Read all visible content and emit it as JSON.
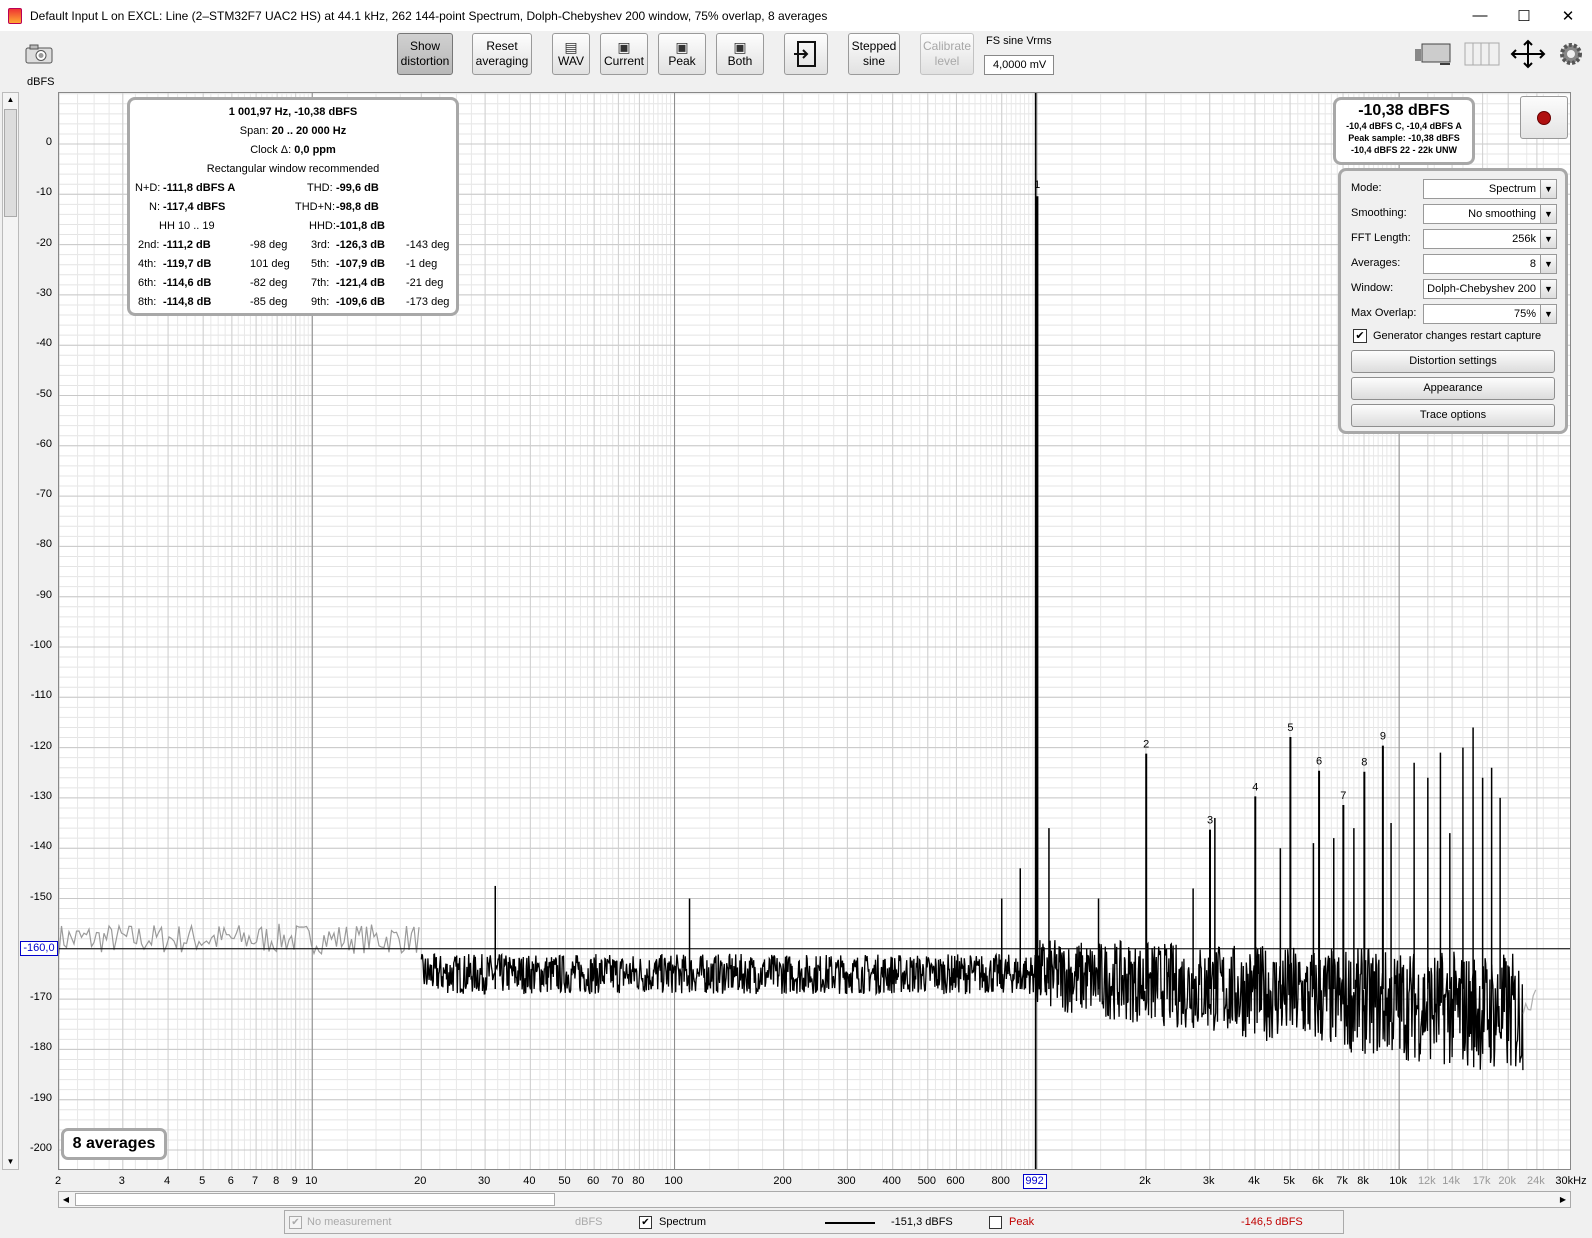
{
  "window": {
    "title": "Default Input L on EXCL: Line (2–STM32F7 UAC2 HS) at 44.1 kHz, 262 144-point Spectrum, Dolph-Chebyshev 200 window, 75% overlap, 8 averages",
    "minimize": "—",
    "maximize": "☐",
    "close": "✕"
  },
  "toolbar": {
    "show_distortion": [
      "Show",
      "distortion"
    ],
    "reset_averaging": [
      "Reset",
      "averaging"
    ],
    "wav": "WAV",
    "current": "Current",
    "peak": "Peak",
    "both": "Both",
    "stepped_sine": [
      "Stepped",
      "sine"
    ],
    "calibrate_level": [
      "Calibrate",
      "level"
    ],
    "fs_sine_label": "FS sine Vrms",
    "fs_sine_value": "4,0000 mV"
  },
  "icons": [
    "camera-icon",
    "save-icon",
    "folder-icon",
    "import-icon",
    "layout-icon",
    "columns-icon",
    "expand-icon",
    "gear-icon"
  ],
  "chart_data": {
    "type": "line",
    "ylabel": "dBFS",
    "ylim": [
      -200,
      10
    ],
    "xscale": "log",
    "xlim": [
      2,
      30000
    ],
    "y_ticks": [
      0,
      -10,
      -20,
      -30,
      -40,
      -50,
      -60,
      -70,
      -80,
      -90,
      -100,
      -110,
      -120,
      -130,
      -140,
      -150,
      -160,
      -170,
      -180,
      -190,
      -200
    ],
    "x_ticks": [
      {
        "v": 2,
        "l": "2"
      },
      {
        "v": 3,
        "l": "3"
      },
      {
        "v": 4,
        "l": "4"
      },
      {
        "v": 5,
        "l": "5"
      },
      {
        "v": 6,
        "l": "6"
      },
      {
        "v": 7,
        "l": "7"
      },
      {
        "v": 8,
        "l": "8"
      },
      {
        "v": 9,
        "l": "9"
      },
      {
        "v": 10,
        "l": "10"
      },
      {
        "v": 20,
        "l": "20"
      },
      {
        "v": 30,
        "l": "30"
      },
      {
        "v": 40,
        "l": "40"
      },
      {
        "v": 50,
        "l": "50"
      },
      {
        "v": 60,
        "l": "60"
      },
      {
        "v": 70,
        "l": "70"
      },
      {
        "v": 80,
        "l": "80"
      },
      {
        "v": 100,
        "l": "100"
      },
      {
        "v": 200,
        "l": "200"
      },
      {
        "v": 300,
        "l": "300"
      },
      {
        "v": 400,
        "l": "400"
      },
      {
        "v": 500,
        "l": "500"
      },
      {
        "v": 600,
        "l": "600"
      },
      {
        "v": 800,
        "l": "800"
      },
      {
        "v": 2000,
        "l": "2k"
      },
      {
        "v": 3000,
        "l": "3k"
      },
      {
        "v": 4000,
        "l": "4k"
      },
      {
        "v": 5000,
        "l": "5k"
      },
      {
        "v": 6000,
        "l": "6k"
      },
      {
        "v": 7000,
        "l": "7k"
      },
      {
        "v": 8000,
        "l": "8k"
      },
      {
        "v": 10000,
        "l": "10k"
      }
    ],
    "x_ticks_minor": [
      {
        "v": 12000,
        "l": "12k"
      },
      {
        "v": 14000,
        "l": "14k"
      },
      {
        "v": 17000,
        "l": "17k"
      },
      {
        "v": 20000,
        "l": "20k"
      },
      {
        "v": 24000,
        "l": "24k"
      },
      {
        "v": 30000,
        "l": "30kHz"
      }
    ],
    "cursor_x": {
      "value": 992,
      "label": "992"
    },
    "cursor_y": {
      "value": -160,
      "label": "-160,0"
    },
    "fundamental": {
      "freq": 1002,
      "level": -10.38,
      "label": "1"
    },
    "harmonics": [
      {
        "n": "2",
        "freq": 2004,
        "level": -121.2
      },
      {
        "n": "3",
        "freq": 3006,
        "level": -136.3
      },
      {
        "n": "4",
        "freq": 4008,
        "level": -129.7
      },
      {
        "n": "5",
        "freq": 5010,
        "level": -117.9
      },
      {
        "n": "6",
        "freq": 6012,
        "level": -124.6
      },
      {
        "n": "7",
        "freq": 7014,
        "level": -131.4
      },
      {
        "n": "8",
        "freq": 8016,
        "level": -124.8
      },
      {
        "n": "9",
        "freq": 9018,
        "level": -119.6
      }
    ],
    "spurs": [
      {
        "freq": 32,
        "level": -147.5
      },
      {
        "freq": 110,
        "level": -150
      },
      {
        "freq": 800,
        "level": -150
      },
      {
        "freq": 900,
        "level": -144
      },
      {
        "freq": 1080,
        "level": -136
      },
      {
        "freq": 1480,
        "level": -150
      },
      {
        "freq": 2700,
        "level": -148
      },
      {
        "freq": 3100,
        "level": -134
      },
      {
        "freq": 4700,
        "level": -140
      },
      {
        "freq": 5800,
        "level": -139
      },
      {
        "freq": 6600,
        "level": -138
      },
      {
        "freq": 7500,
        "level": -136
      },
      {
        "freq": 9500,
        "level": -135
      },
      {
        "freq": 11000,
        "level": -123
      },
      {
        "freq": 12000,
        "level": -126
      },
      {
        "freq": 13000,
        "level": -121
      },
      {
        "freq": 13800,
        "level": -137
      },
      {
        "freq": 15000,
        "level": -120
      },
      {
        "freq": 16000,
        "level": -116
      },
      {
        "freq": 17000,
        "level": -126
      },
      {
        "freq": 18000,
        "level": -124
      },
      {
        "freq": 19000,
        "level": -130
      }
    ],
    "noise_floor_segments": [
      {
        "from": 2,
        "to": 20,
        "level": -158,
        "color": "#9a9a9a"
      },
      {
        "from": 20,
        "to": 22000,
        "level": -165,
        "color": "#000000"
      },
      {
        "from": 22000,
        "to": 24000,
        "level": -170,
        "color": "#b0b0b0"
      }
    ]
  },
  "info_panel": {
    "headline": "1 001,97 Hz, -10,38 dBFS",
    "span_label": "Span:",
    "span_value": "20 .. 20 000 Hz",
    "clock_label": "Clock Δ:",
    "clock_value": "0,0 ppm",
    "recommend": "Rectangular window recommended",
    "nd_label": "N+D:",
    "nd_value": "-111,8 dBFS A",
    "thd_label": "THD:",
    "thd_value": "-99,6 dB",
    "n_label": "N:",
    "n_value": "-117,4 dBFS",
    "thdn_label": "THD+N:",
    "thdn_value": "-98,8 dB",
    "hh_label": "HH 10 .. 19",
    "hhd_label": "HHD:",
    "hhd_value": "-101,8 dB",
    "harmonics": [
      {
        "l1": "2nd:",
        "v1": "-111,2 dB",
        "p1": "-98 deg",
        "l2": "3rd:",
        "v2": "-126,3 dB",
        "p2": "-143 deg"
      },
      {
        "l1": "4th:",
        "v1": "-119,7 dB",
        "p1": "101 deg",
        "l2": "5th:",
        "v2": "-107,9 dB",
        "p2": "-1 deg"
      },
      {
        "l1": "6th:",
        "v1": "-114,6 dB",
        "p1": "-82 deg",
        "l2": "7th:",
        "v2": "-121,4 dB",
        "p2": "-21 deg"
      },
      {
        "l1": "8th:",
        "v1": "-114,8 dB",
        "p1": "-85 deg",
        "l2": "9th:",
        "v2": "-109,6 dB",
        "p2": "-173 deg"
      }
    ]
  },
  "level_box": {
    "big": "-10,38 dBFS",
    "line1": "-10,4 dBFS C, -10,4 dBFS A",
    "line2": "Peak sample: -10,38 dBFS",
    "line3": "-10,4 dBFS 22 - 22k UNW"
  },
  "settings": {
    "mode_label": "Mode:",
    "mode_value": "Spectrum",
    "smoothing_label": "Smoothing:",
    "smoothing_value": "No  smoothing",
    "fft_label": "FFT Length:",
    "fft_value": "256k",
    "averages_label": "Averages:",
    "averages_value": "8",
    "window_label": "Window:",
    "window_value": "Dolph-Chebyshev 200",
    "overlap_label": "Max Overlap:",
    "overlap_value": "75%",
    "restart_label": "Generator changes restart capture",
    "restart_checked": "✔",
    "distortion_btn": "Distortion settings",
    "appearance_btn": "Appearance",
    "trace_btn": "Trace options"
  },
  "averages_badge": "8 averages",
  "legend": {
    "no_measurement": "No measurement",
    "unit": "dBFS",
    "spectrum_label": "Spectrum",
    "spectrum_value": "-151,3 dBFS",
    "peak_label": "Peak",
    "peak_value": "-146,5 dBFS",
    "check": "✔",
    "peak_color": "#c00000"
  }
}
